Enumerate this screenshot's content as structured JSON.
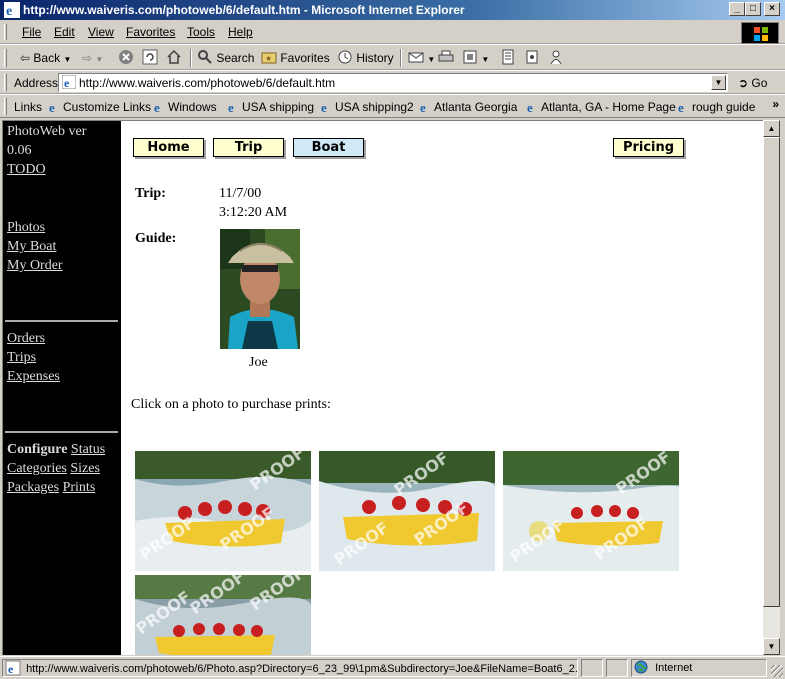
{
  "window": {
    "title": "http://www.waiveris.com/photoweb/6/default.htm - Microsoft Internet Explorer",
    "controls": {
      "minimize": "_",
      "maximize": "□",
      "close": "×"
    }
  },
  "menu": [
    {
      "label": "File"
    },
    {
      "label": "Edit"
    },
    {
      "label": "View"
    },
    {
      "label": "Favorites"
    },
    {
      "label": "Tools"
    },
    {
      "label": "Help"
    }
  ],
  "toolbar": {
    "back": "Back",
    "search": "Search",
    "favorites": "Favorites",
    "history": "History"
  },
  "address": {
    "label": "Address",
    "url": "http://www.waiveris.com/photoweb/6/default.htm",
    "go": "Go"
  },
  "links": {
    "label": "Links",
    "items": [
      {
        "label": "Customize Links"
      },
      {
        "label": "Windows"
      },
      {
        "label": "USA shipping"
      },
      {
        "label": "USA shipping2"
      },
      {
        "label": "Atlanta Georgia"
      },
      {
        "label": "Atlanta, GA - Home Page"
      },
      {
        "label": "rough guide"
      }
    ],
    "more": "»"
  },
  "sidebar": {
    "app_name": "PhotoWeb ver",
    "version": "0.06",
    "todo": "TODO",
    "group1": [
      "Photos",
      "My Boat",
      "My Order"
    ],
    "group2": [
      "Orders",
      "Trips",
      "Expenses"
    ],
    "configure": "Configure",
    "status": "Status",
    "categories": "Categories",
    "sizes": "Sizes",
    "packages": "Packages",
    "prints": "Prints"
  },
  "nav": {
    "home": "Home",
    "trip": "Trip",
    "boat": "Boat",
    "pricing": "Pricing"
  },
  "trip": {
    "label": "Trip:",
    "date": "11/7/00",
    "time": "3:12:20 AM"
  },
  "guide": {
    "label": "Guide:",
    "name": "Joe"
  },
  "instructions": "Click on a photo to purchase prints:",
  "photos": [
    {
      "watermark": "PROOF"
    },
    {
      "watermark": "PROOF"
    },
    {
      "watermark": "PROOF"
    },
    {
      "watermark": "PROOF"
    }
  ],
  "status": {
    "url": "http://www.waiveris.com/photoweb/6/Photo.asp?Directory=6_23_99\\1pm&Subdirectory=Joe&FileName=Boat6_2...",
    "zone": "Internet"
  },
  "colors": {
    "title_gradient_start": "#0a246a",
    "sidebar_bg": "#000000",
    "nav_button_bg": "#ffffd0",
    "nav_button_active_bg": "#cfe9f6"
  }
}
